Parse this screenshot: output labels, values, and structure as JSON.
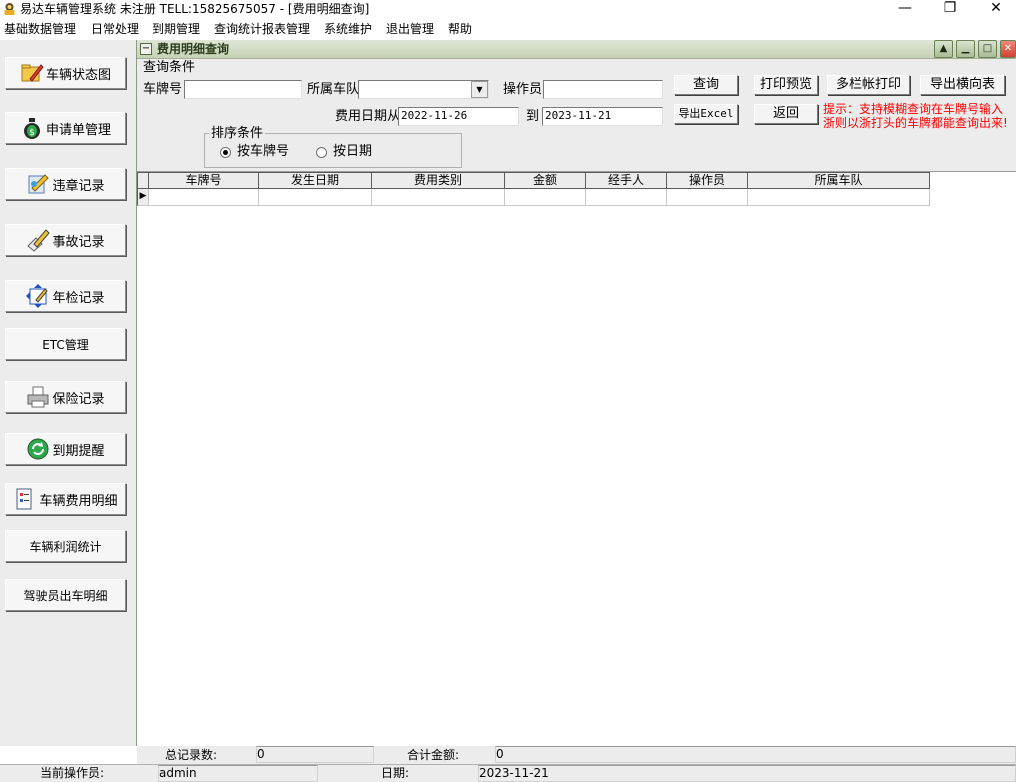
{
  "window": {
    "title": "易达车辆管理系统 未注册 TELL:15825675057 - [费用明细查询]",
    "controls": [
      "—",
      "❐",
      "✕"
    ]
  },
  "menu": [
    "基础数据管理",
    "日常处理",
    "到期管理",
    "查询统计报表管理",
    "系统维护",
    "退出管理",
    "帮助"
  ],
  "nav": [
    {
      "label": "车辆状态图",
      "icon": "folder-pencil-icon"
    },
    {
      "label": "申请单管理",
      "icon": "money-bag-icon"
    },
    {
      "label": "违章记录",
      "icon": "document-edit-icon"
    },
    {
      "label": "事故记录",
      "icon": "pen-paper-icon"
    },
    {
      "label": "年检记录",
      "icon": "calendar-arrows-icon"
    },
    {
      "label": "ETC管理",
      "icon": ""
    },
    {
      "label": "保险记录",
      "icon": "printer-icon"
    },
    {
      "label": "到期提醒",
      "icon": "refresh-globe-icon"
    },
    {
      "label": "车辆费用明细",
      "icon": "document-list-icon"
    },
    {
      "label": "车辆利润统计",
      "icon": ""
    },
    {
      "label": "驾驶员出车明细",
      "icon": ""
    }
  ],
  "subwindow": {
    "title": "费用明细查询",
    "controls": [
      "▲",
      "▁",
      "□",
      "✕"
    ]
  },
  "query": {
    "group_label": "查询条件",
    "plate_label": "车牌号",
    "plate_value": "",
    "fleet_label": "所属车队",
    "fleet_value": "",
    "operator_label": "操作员",
    "operator_value": "",
    "date_from_label": "费用日期从",
    "date_from": "2022-11-26",
    "date_to_label": "到",
    "date_to": "2023-11-21",
    "hint_line1": "提示：支持模糊查询在车牌号输入",
    "hint_line2": "浙则以浙打头的车牌都能查询出来!"
  },
  "buttons": {
    "search": "查询",
    "print_preview": "打印预览",
    "multi_print": "多栏帐打印",
    "export_horizontal": "导出横向表",
    "export_excel": "导出Excel",
    "back": "返回"
  },
  "sort": {
    "group_label": "排序条件",
    "option_plate": "按车牌号",
    "option_date": "按日期",
    "selected": "按车牌号"
  },
  "grid": {
    "columns": [
      "车牌号",
      "发生日期",
      "费用类别",
      "金额",
      "经手人",
      "操作员",
      "所属车队"
    ],
    "row_marker": "▶"
  },
  "summary": {
    "total_records_label": "总记录数:",
    "total_records": "0",
    "total_amount_label": "合计金额:",
    "total_amount": "0"
  },
  "status": {
    "operator_label": "当前操作员:",
    "operator": "admin",
    "date_label": "日期:",
    "date": "2023-11-21"
  }
}
